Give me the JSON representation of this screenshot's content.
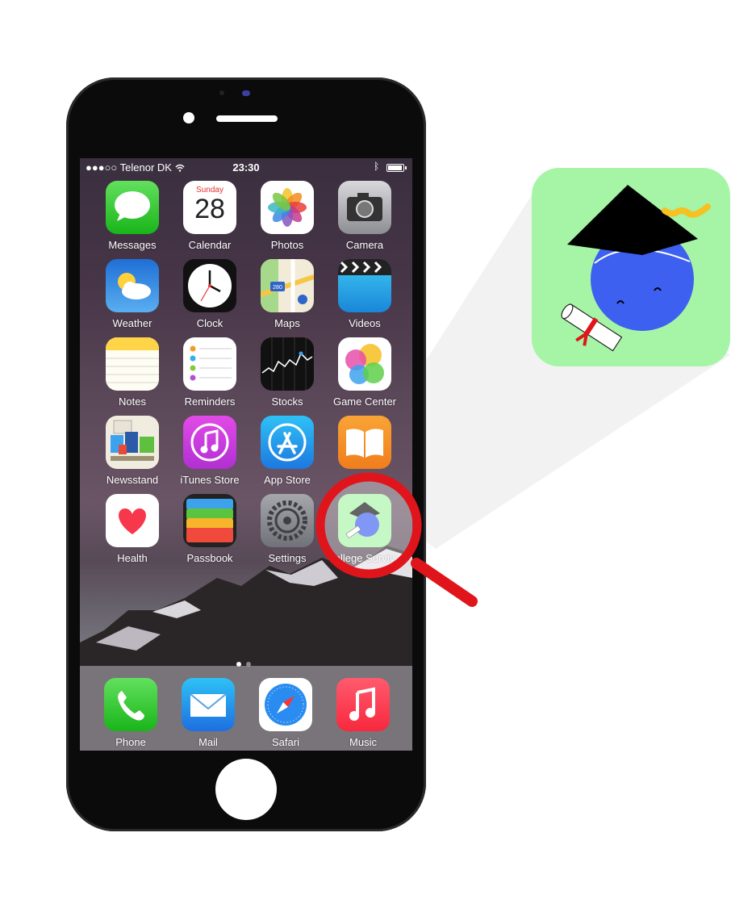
{
  "status_bar": {
    "carrier": "●●●○○ Telenor DK",
    "wifi_icon": "wifi-icon",
    "time": "23:30",
    "bluetooth_icon": "bluetooth-icon"
  },
  "calendar": {
    "day": "Sunday",
    "date": "28"
  },
  "maps": {
    "route_number": "280"
  },
  "apps": [
    {
      "label": "Messages",
      "icon": "messages-icon"
    },
    {
      "label": "Calendar",
      "icon": "calendar-icon"
    },
    {
      "label": "Photos",
      "icon": "photos-icon"
    },
    {
      "label": "Camera",
      "icon": "camera-icon"
    },
    {
      "label": "Weather",
      "icon": "weather-icon"
    },
    {
      "label": "Clock",
      "icon": "clock-icon"
    },
    {
      "label": "Maps",
      "icon": "maps-icon"
    },
    {
      "label": "Videos",
      "icon": "videos-icon"
    },
    {
      "label": "Notes",
      "icon": "notes-icon"
    },
    {
      "label": "Reminders",
      "icon": "reminders-icon"
    },
    {
      "label": "Stocks",
      "icon": "stocks-icon"
    },
    {
      "label": "Game Center",
      "icon": "game-center-icon"
    },
    {
      "label": "Newsstand",
      "icon": "newsstand-icon"
    },
    {
      "label": "iTunes Store",
      "icon": "itunes-store-icon"
    },
    {
      "label": "App Store",
      "icon": "app-store-icon"
    },
    {
      "label": "",
      "icon": "ibooks-icon"
    },
    {
      "label": "Health",
      "icon": "health-icon"
    },
    {
      "label": "Passbook",
      "icon": "passbook-icon"
    },
    {
      "label": "Settings",
      "icon": "settings-icon"
    },
    {
      "label": "ollege Surviv",
      "icon": "college-survival-icon"
    }
  ],
  "dock": [
    {
      "label": "Phone",
      "icon": "phone-icon"
    },
    {
      "label": "Mail",
      "icon": "mail-icon"
    },
    {
      "label": "Safari",
      "icon": "safari-icon"
    },
    {
      "label": "Music",
      "icon": "music-icon"
    }
  ],
  "page_indicator": {
    "pages": 2,
    "current": 1
  },
  "colors": {
    "magnifier_red": "#e0151b",
    "zoom_background": "#a6f5a6",
    "mascot_blue": "#3d60f0"
  }
}
